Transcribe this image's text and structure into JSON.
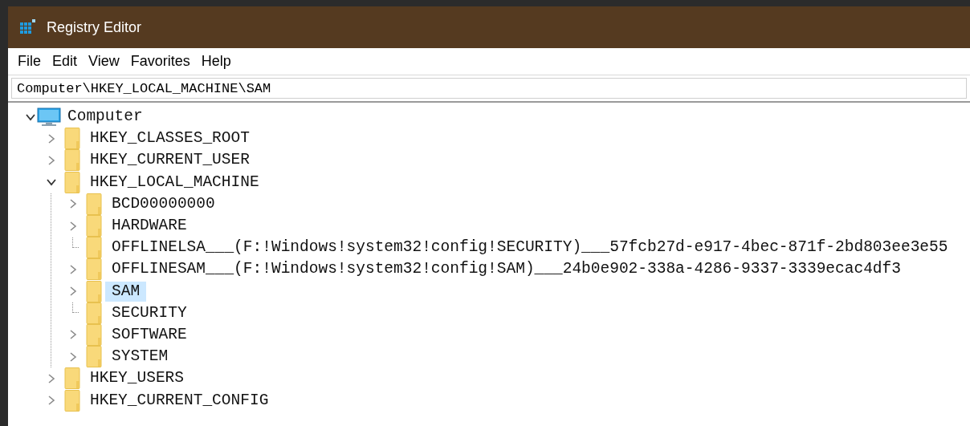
{
  "window": {
    "title": "Registry Editor"
  },
  "menu": [
    "File",
    "Edit",
    "View",
    "Favorites",
    "Help"
  ],
  "address_bar": {
    "value": "Computer\\HKEY_LOCAL_MACHINE\\SAM"
  },
  "tree": [
    {
      "kind": "computer",
      "label": "Computer",
      "expandable": true,
      "expanded": true,
      "selected": false,
      "children": [
        {
          "kind": "folder",
          "label": "HKEY_CLASSES_ROOT",
          "expandable": true,
          "expanded": false,
          "selected": false
        },
        {
          "kind": "folder",
          "label": "HKEY_CURRENT_USER",
          "expandable": true,
          "expanded": false,
          "selected": false
        },
        {
          "kind": "folder",
          "label": "HKEY_LOCAL_MACHINE",
          "expandable": true,
          "expanded": true,
          "selected": false,
          "children": [
            {
              "kind": "folder",
              "label": "BCD00000000",
              "expandable": true,
              "expanded": false,
              "selected": false
            },
            {
              "kind": "folder",
              "label": "HARDWARE",
              "expandable": true,
              "expanded": false,
              "selected": false
            },
            {
              "kind": "folder",
              "label": "OFFLINELSA___(F:!Windows!system32!config!SECURITY)___57fcb27d-e917-4bec-871f-2bd803ee3e55",
              "expandable": false,
              "selected": false
            },
            {
              "kind": "folder",
              "label": "OFFLINESAM___(F:!Windows!system32!config!SAM)___24b0e902-338a-4286-9337-3339ecac4df3",
              "expandable": true,
              "expanded": false,
              "selected": false
            },
            {
              "kind": "folder",
              "label": "SAM",
              "expandable": true,
              "expanded": false,
              "selected": true
            },
            {
              "kind": "folder",
              "label": "SECURITY",
              "expandable": false,
              "selected": false
            },
            {
              "kind": "folder",
              "label": "SOFTWARE",
              "expandable": true,
              "expanded": false,
              "selected": false
            },
            {
              "kind": "folder",
              "label": "SYSTEM",
              "expandable": true,
              "expanded": false,
              "selected": false
            }
          ]
        },
        {
          "kind": "folder",
          "label": "HKEY_USERS",
          "expandable": true,
          "expanded": false,
          "selected": false
        },
        {
          "kind": "folder",
          "label": "HKEY_CURRENT_CONFIG",
          "expandable": true,
          "expanded": false,
          "selected": false
        }
      ]
    }
  ]
}
